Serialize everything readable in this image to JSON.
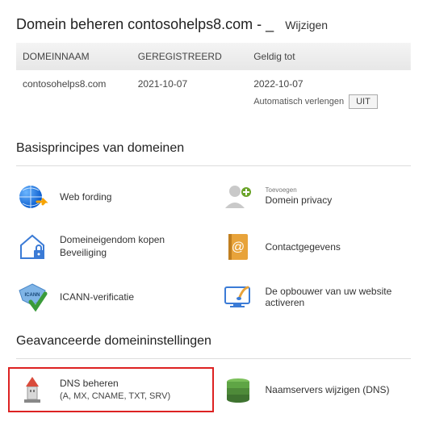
{
  "header": {
    "title": "Domein beheren contosohelps8.com - _",
    "change": "Wijzigen"
  },
  "table": {
    "headers": {
      "name": "DOMEINNAAM",
      "reg": "GEREGISTREERD",
      "valid": "Geldig tot"
    },
    "row": {
      "name": "contosohelps8.com",
      "reg": "2021-10-07",
      "valid": "2022-10-07",
      "auto_label": "Automatisch verlengen",
      "toggle": "UIT"
    }
  },
  "basics": {
    "heading": "Basisprincipes van domeinen",
    "items": {
      "web_forwarding": "Web fording",
      "privacy_add": "Toevoegen",
      "privacy": "Domein privacy",
      "ownership1": "Domeineigendom kopen",
      "ownership2": "Beveiliging",
      "contact": "Contactgegevens",
      "icann": "ICANN-verificatie",
      "builder": "De opbouwer van uw website activeren"
    }
  },
  "advanced": {
    "heading": "Geavanceerde domeininstellingen",
    "dns_label": "DNS beheren",
    "dns_sub": "(A, MX, CNAME, TXT, SRV)",
    "ns_label": "Naamservers wijzigen (DNS)"
  }
}
